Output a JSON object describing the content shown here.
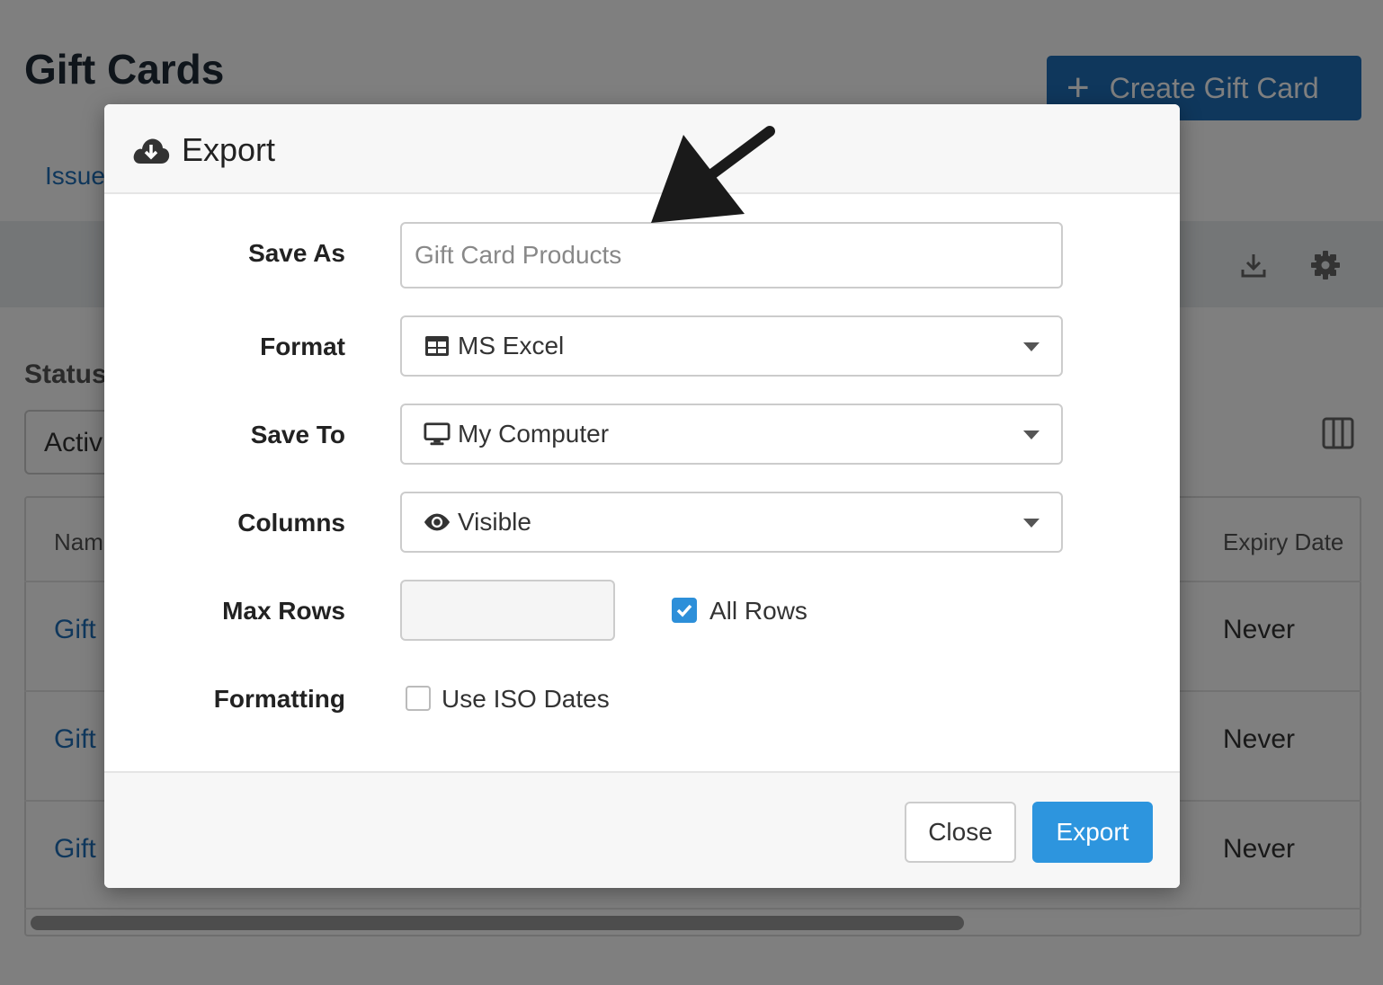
{
  "page": {
    "title": "Gift Cards",
    "create_button": "Create Gift Card",
    "tab_issued": "Issue",
    "status_label": "Status",
    "status_value": "Activ",
    "table": {
      "col_name": "Nam",
      "col_expiry": "Expiry Date",
      "rows": [
        {
          "name": "Gift",
          "expiry": "Never"
        },
        {
          "name": "Gift",
          "expiry": "Never"
        },
        {
          "name": "Gift",
          "expiry": "Never"
        }
      ]
    },
    "icons": [
      "download-icon",
      "settings-icon",
      "columns-icon",
      "plus-icon"
    ]
  },
  "modal": {
    "title": "Export",
    "title_icon": "cloud-download-icon",
    "fields": {
      "save_as": {
        "label": "Save As",
        "placeholder": "Gift Card Products",
        "value": ""
      },
      "format": {
        "label": "Format",
        "value": "MS Excel",
        "icon": "table-icon"
      },
      "save_to": {
        "label": "Save To",
        "value": "My Computer",
        "icon": "desktop-icon"
      },
      "columns": {
        "label": "Columns",
        "value": "Visible",
        "icon": "eye-icon"
      },
      "max_rows": {
        "label": "Max Rows",
        "value": "",
        "all_rows_label": "All Rows",
        "all_rows_checked": true
      },
      "formatting": {
        "label": "Formatting",
        "iso_dates_label": "Use ISO Dates",
        "iso_dates_checked": false
      }
    },
    "buttons": {
      "close": "Close",
      "export": "Export"
    }
  },
  "colors": {
    "primary": "#2d95de",
    "brand": "#1e6fb8",
    "overlay": "rgba(0,0,0,0.5)"
  }
}
